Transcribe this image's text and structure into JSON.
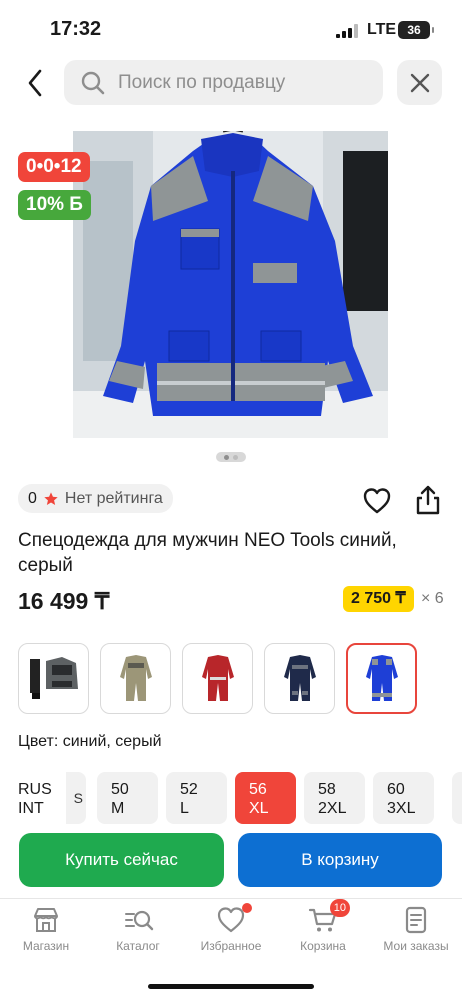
{
  "status_bar": {
    "time": "17:32",
    "network": "LTE",
    "battery": "36"
  },
  "search": {
    "placeholder": "Поиск по продавцу",
    "icon": "search-icon"
  },
  "product": {
    "timer_badge": "0•0•12",
    "discount_badge": "10% Б",
    "rating_count": "0",
    "rating_label": "Нет рейтинга",
    "title": "Спецодежда для мужчин NEO Tools синий, серый",
    "price": "16 499 ₸",
    "installment_price": "2 750 ₸",
    "installment_months": "× 6",
    "color_label": "Цвет: синий, серый",
    "photo_count": 2,
    "photo_current": 1
  },
  "variants": [
    {
      "name": "variant-grey-black",
      "active": false
    },
    {
      "name": "variant-beige",
      "active": false
    },
    {
      "name": "variant-red",
      "active": false
    },
    {
      "name": "variant-navy",
      "active": false
    },
    {
      "name": "variant-blue-grey",
      "active": true
    }
  ],
  "sizes": {
    "scale_label": "RUS\nINT",
    "partial": "S",
    "items": [
      {
        "rus": "50",
        "int": "M",
        "active": false
      },
      {
        "rus": "52",
        "int": "L",
        "active": false
      },
      {
        "rus": "56",
        "int": "XL",
        "active": true
      },
      {
        "rus": "58",
        "int": "2XL",
        "active": false
      },
      {
        "rus": "60",
        "int": "3XL",
        "active": false
      }
    ]
  },
  "actions": {
    "buy_now": "Купить сейчас",
    "to_cart": "В корзину"
  },
  "nav": {
    "items": [
      {
        "label": "Магазин",
        "icon": "store-icon"
      },
      {
        "label": "Каталог",
        "icon": "catalog-search-icon"
      },
      {
        "label": "Избранное",
        "icon": "heart-icon"
      },
      {
        "label": "Корзина",
        "icon": "cart-icon",
        "badge": "10"
      },
      {
        "label": "Мои заказы",
        "icon": "orders-icon"
      }
    ]
  },
  "colors": {
    "timer_red": "#f0453a",
    "discount_green": "#47a83c",
    "buy_green": "#1faa4f",
    "cart_blue": "#0d6fd2",
    "installment_yellow": "#ffd500",
    "jacket_blue": "#1e3fd6",
    "jacket_grey": "#8f9596"
  }
}
